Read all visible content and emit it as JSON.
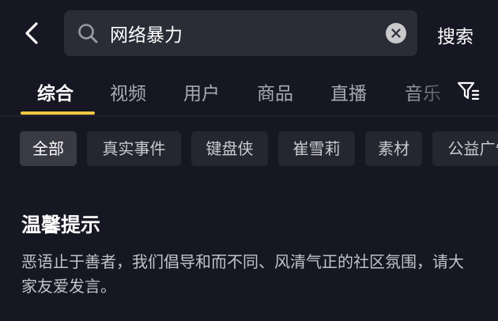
{
  "search": {
    "query": "网络暴力",
    "action_label": "搜索"
  },
  "tabs": [
    {
      "label": "综合",
      "active": true
    },
    {
      "label": "视频",
      "active": false
    },
    {
      "label": "用户",
      "active": false
    },
    {
      "label": "商品",
      "active": false
    },
    {
      "label": "直播",
      "active": false
    },
    {
      "label": "音乐",
      "active": false
    }
  ],
  "chips": [
    {
      "label": "全部",
      "active": true
    },
    {
      "label": "真实事件",
      "active": false
    },
    {
      "label": "键盘侠",
      "active": false
    },
    {
      "label": "崔雪莉",
      "active": false
    },
    {
      "label": "素材",
      "active": false
    },
    {
      "label": "公益广告",
      "active": false
    }
  ],
  "notice": {
    "title": "温馨提示",
    "body": "恶语止于善者，我们倡导和而不同、风清气正的社区氛围，请大家友爱发言。"
  },
  "colors": {
    "background": "#161722",
    "accent": "#f7c843",
    "search_bg": "#2a2c36"
  },
  "icons": {
    "back": "chevron-left-icon",
    "search": "magnifier-icon",
    "clear": "close-circle-icon",
    "filter": "funnel-icon"
  }
}
